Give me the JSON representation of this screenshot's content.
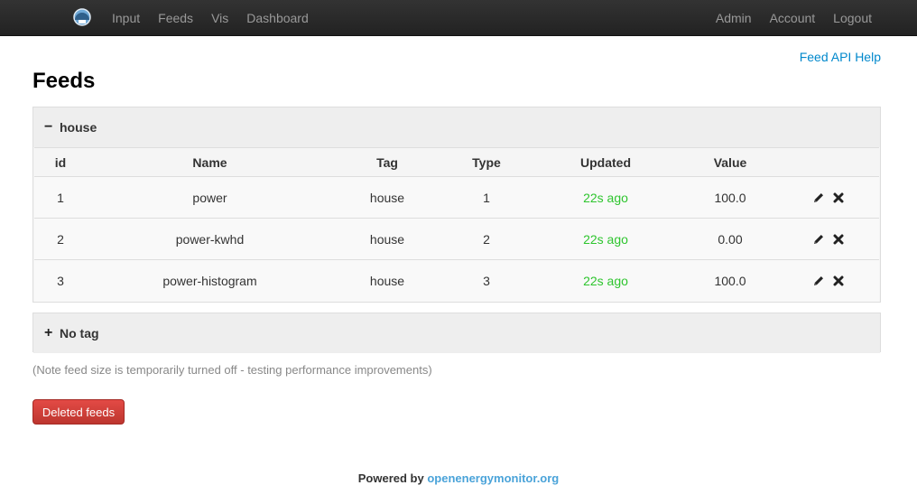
{
  "nav": {
    "logo_icon": "energy-meter-icon",
    "left": [
      "Input",
      "Feeds",
      "Vis",
      "Dashboard"
    ],
    "right": [
      "Admin",
      "Account",
      "Logout"
    ]
  },
  "header": {
    "api_help": "Feed API Help",
    "title": "Feeds"
  },
  "groups": {
    "house": {
      "toggle": "−",
      "name": "house",
      "columns": [
        "id",
        "Name",
        "Tag",
        "Type",
        "Updated",
        "Value"
      ],
      "rows": [
        {
          "id": "1",
          "name": "power",
          "tag": "house",
          "type": "1",
          "updated": "22s ago",
          "value": "100.0"
        },
        {
          "id": "2",
          "name": "power-kwhd",
          "tag": "house",
          "type": "2",
          "updated": "22s ago",
          "value": "0.00"
        },
        {
          "id": "3",
          "name": "power-histogram",
          "tag": "house",
          "type": "3",
          "updated": "22s ago",
          "value": "100.0"
        }
      ],
      "action_icons": [
        "pencil-icon",
        "delete-x-icon"
      ]
    },
    "notag": {
      "toggle": "+",
      "name": "No tag"
    }
  },
  "note": "(Note feed size is temporarily turned off - testing performance improvements)",
  "deleted_button": "Deleted feeds",
  "footer": {
    "prefix": "Powered by",
    "link": "openenergymonitor.org"
  },
  "colors": {
    "navbar": "#222222",
    "link": "#0088cc",
    "updated": "#2ec52e",
    "danger": "#da4f49"
  }
}
